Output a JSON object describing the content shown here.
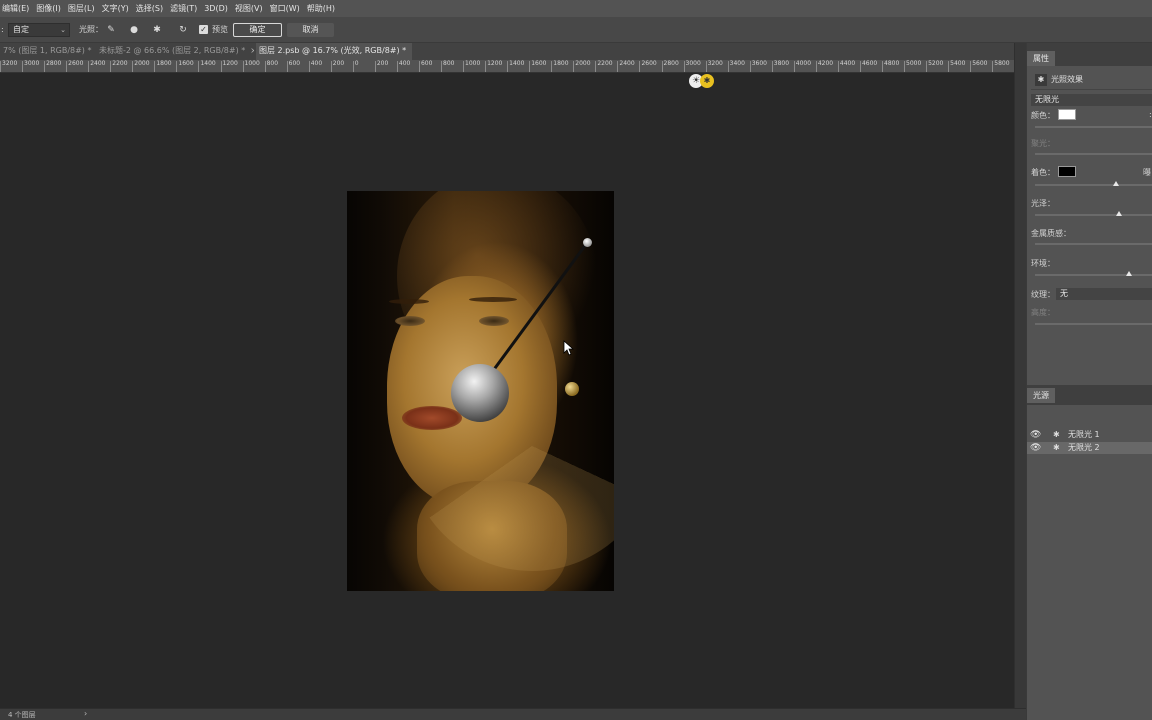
{
  "menu": [
    "编辑(E)",
    "图像(I)",
    "图层(L)",
    "文字(Y)",
    "选择(S)",
    "滤镜(T)",
    "3D(D)",
    "视图(V)",
    "窗口(W)",
    "帮助(H)"
  ],
  "options": {
    "preset_value": "自定",
    "light_label": "光照：",
    "preview_label": "预览",
    "preview_checked": true,
    "ok_label": "确定",
    "cancel_label": "取消"
  },
  "tabs": [
    {
      "label": "7% (图层 1, RGB/8#) *",
      "close": "×",
      "active": false
    },
    {
      "label": "未标题-2 @ 66.6% (图层 2, RGB/8#) *",
      "close": "×",
      "active": false
    },
    {
      "label": "图层 2.psb @ 16.7% (光效, RGB/8#) *",
      "close": "×",
      "active": true
    }
  ],
  "ruler_ticks": [
    "3200",
    "3000",
    "2800",
    "2600",
    "2400",
    "2200",
    "2000",
    "1800",
    "1600",
    "1400",
    "1200",
    "1000",
    "800",
    "600",
    "400",
    "200",
    "0",
    "200",
    "400",
    "600",
    "800",
    "1000",
    "1200",
    "1400",
    "1600",
    "1800",
    "2000",
    "2200",
    "2400",
    "2600",
    "2800",
    "3000",
    "3200",
    "3400",
    "3600",
    "3800",
    "4000",
    "4200",
    "4400",
    "4600",
    "4800",
    "5000",
    "5200",
    "5400",
    "5600",
    "5800"
  ],
  "status": {
    "layers_count": "4 个图层",
    "arrow": "›"
  },
  "properties": {
    "tab": "属性",
    "title": "光照效果",
    "light_type": "无限光",
    "color_label": "颜色：",
    "color_value": "#ffffff",
    "hotspot_label": "聚光：",
    "colorize_label": "着色：",
    "colorize_value": "#000000",
    "exposure_partial": "曝",
    "gloss_label": "光泽：",
    "metallic_label": "金属质感：",
    "ambience_label": "环境：",
    "texture_label": "纹理：",
    "texture_value": "无",
    "height_label": "高度：",
    "colorize_level": 0.69,
    "gloss_level": 0.71,
    "ambience_level": 0.8
  },
  "lights_panel": {
    "tab": "光源",
    "items": [
      {
        "name": "无限光 1",
        "selected": false
      },
      {
        "name": "无限光 2",
        "selected": true
      }
    ]
  },
  "colors": {
    "accent_yellow": "#e8c020",
    "panel_bg": "#535353",
    "canvas_bg": "#282828"
  }
}
